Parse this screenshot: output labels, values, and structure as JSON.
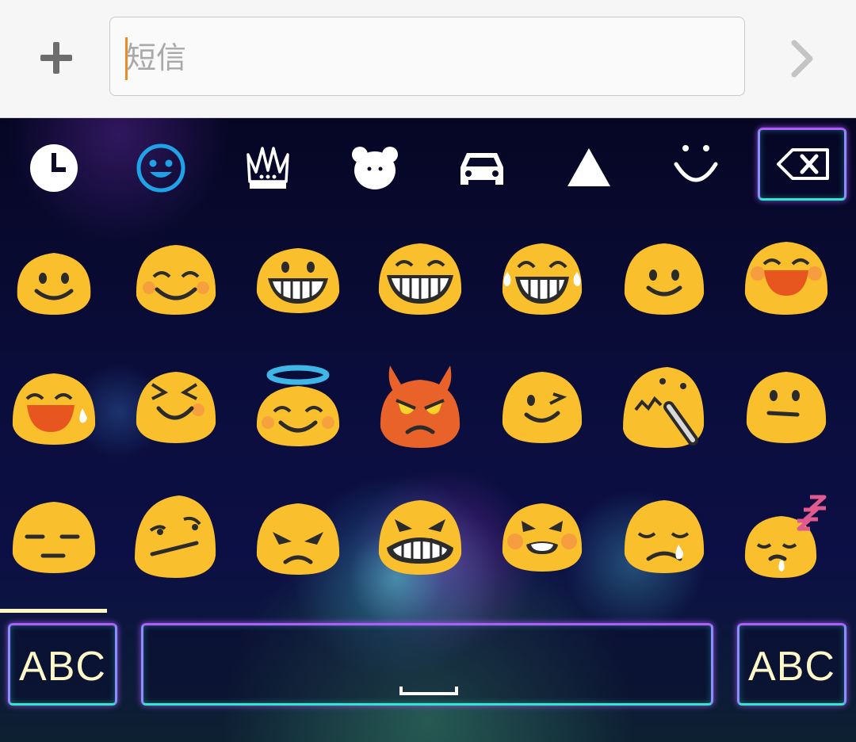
{
  "composer": {
    "placeholder": "短信",
    "add_icon": "plus-icon",
    "send_icon": "chevron-right-icon"
  },
  "keyboard": {
    "categories": [
      {
        "name": "recent",
        "icon": "clock-icon",
        "selected": false
      },
      {
        "name": "smileys",
        "icon": "smiley-face-icon",
        "selected": true
      },
      {
        "name": "objects",
        "icon": "crown-icon",
        "selected": false
      },
      {
        "name": "animals",
        "icon": "bear-icon",
        "selected": false
      },
      {
        "name": "travel",
        "icon": "car-icon",
        "selected": false
      },
      {
        "name": "symbols",
        "icon": "triangle-icon",
        "selected": false
      },
      {
        "name": "emoticons",
        "icon": "emoticon-icon",
        "selected": false
      }
    ],
    "backspace_icon": "backspace-icon",
    "emoji_rows": [
      [
        "smiling-face",
        "smiling-eyes-face",
        "grinning-face",
        "beaming-face",
        "tears-of-joy-face",
        "slightly-smiling-face",
        "happy-blush-face"
      ],
      [
        "sweat-smile-face",
        "squinting-face",
        "halo-face",
        "smiling-devil-face",
        "winking-face",
        "confounded-face",
        "neutral-face"
      ],
      [
        "expressionless-face",
        "unamused-face",
        "angry-face",
        "grimacing-face",
        "persevering-face",
        "crying-face",
        "sleeping-face"
      ]
    ],
    "left_abc_label": "ABC",
    "right_abc_label": "ABC",
    "space_icon": "spacebar-icon",
    "accent_color": "#b05cff",
    "secondary_accent": "#2ee8d2",
    "emoji_yellow": "#f9bf2c"
  }
}
